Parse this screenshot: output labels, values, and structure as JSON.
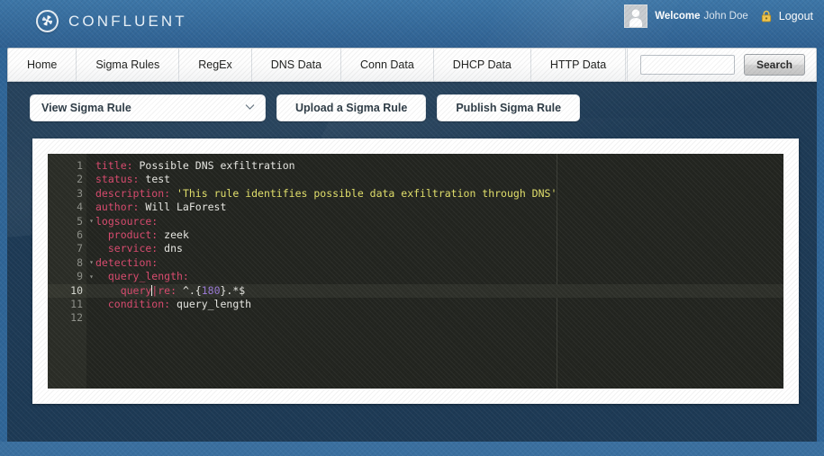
{
  "header": {
    "brand_name": "CONFLUENT",
    "brand_icon": "confluent-pinwheel-icon",
    "welcome_label": "Welcome",
    "user_name": "John Doe",
    "lock_icon": "lock-icon",
    "logout_label": "Logout",
    "avatar_icon": "user-avatar-icon"
  },
  "nav": {
    "items": [
      {
        "label": "Home"
      },
      {
        "label": "Sigma Rules"
      },
      {
        "label": "RegEx"
      },
      {
        "label": "DNS Data"
      },
      {
        "label": "Conn Data"
      },
      {
        "label": "DHCP Data"
      },
      {
        "label": "HTTP Data"
      }
    ],
    "search": {
      "value": "",
      "placeholder": "",
      "button_label": "Search",
      "icon": "search-icon"
    }
  },
  "toolbar": {
    "rule_select": {
      "selected": "View Sigma Rule",
      "chevron_icon": "chevron-down-icon"
    },
    "upload_label": "Upload a Sigma Rule",
    "publish_label": "Publish Sigma Rule"
  },
  "editor": {
    "language": "yaml",
    "active_line": 10,
    "cursor": {
      "line": 10,
      "column": 10
    },
    "fold_lines": [
      5,
      8,
      9
    ],
    "total_lines": 12,
    "colors": {
      "background": "#232520",
      "gutter": "#2b2d27",
      "key": "#d94a6e",
      "value": "#e8e8e3",
      "string": "#e2e06a",
      "number": "#9a79d6",
      "active_line": "#2e302a"
    },
    "lines": [
      {
        "n": "1",
        "tokens": [
          {
            "t": "title:",
            "c": "k"
          },
          {
            "t": " Possible DNS exfiltration",
            "c": "v"
          }
        ]
      },
      {
        "n": "2",
        "tokens": [
          {
            "t": "status:",
            "c": "k"
          },
          {
            "t": " test",
            "c": "v"
          }
        ]
      },
      {
        "n": "3",
        "tokens": [
          {
            "t": "description:",
            "c": "k"
          },
          {
            "t": " ",
            "c": "v"
          },
          {
            "t": "'This rule identifies possible data exfiltration through DNS'",
            "c": "s"
          }
        ]
      },
      {
        "n": "4",
        "tokens": [
          {
            "t": "author:",
            "c": "k"
          },
          {
            "t": " Will LaForest",
            "c": "v"
          }
        ]
      },
      {
        "n": "5",
        "tokens": [
          {
            "t": "logsource:",
            "c": "k"
          }
        ]
      },
      {
        "n": "6",
        "tokens": [
          {
            "t": "  product:",
            "c": "k"
          },
          {
            "t": " zeek",
            "c": "v"
          }
        ]
      },
      {
        "n": "7",
        "tokens": [
          {
            "t": "  service:",
            "c": "k"
          },
          {
            "t": " dns",
            "c": "v"
          }
        ]
      },
      {
        "n": "8",
        "tokens": [
          {
            "t": "detection:",
            "c": "k"
          }
        ]
      },
      {
        "n": "9",
        "tokens": [
          {
            "t": "  query_length:",
            "c": "k"
          }
        ]
      },
      {
        "n": "10",
        "tokens": [
          {
            "t": "    query",
            "c": "k"
          },
          {
            "t": "",
            "c": "caret"
          },
          {
            "t": "|re:",
            "c": "k"
          },
          {
            "t": " ^.{",
            "c": "v"
          },
          {
            "t": "180",
            "c": "num"
          },
          {
            "t": "}.*$",
            "c": "v"
          }
        ]
      },
      {
        "n": "11",
        "tokens": [
          {
            "t": "  condition:",
            "c": "k"
          },
          {
            "t": " query_length",
            "c": "v"
          }
        ]
      },
      {
        "n": "12",
        "tokens": []
      }
    ]
  }
}
